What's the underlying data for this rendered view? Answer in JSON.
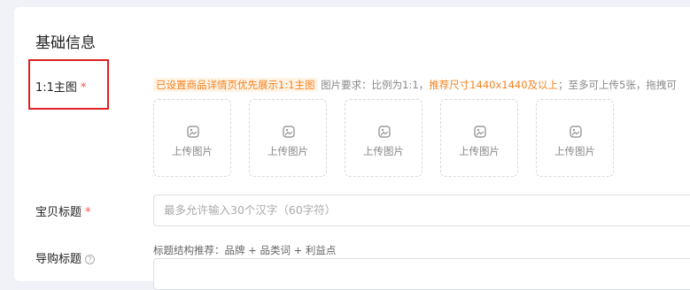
{
  "section": {
    "title": "基础信息"
  },
  "main_image": {
    "label": "1:1主图",
    "required_mark": "*",
    "tip_tag": "已设置商品详情页优先展示1:1主图",
    "tip_text_1": "图片要求：比例为1:1，",
    "tip_text_orange": "推荐尺寸1440x1440及以上",
    "tip_text_2": "；至多可上传5张，拖拽可",
    "upload_slots": [
      {
        "label": "上传图片"
      },
      {
        "label": "上传图片"
      },
      {
        "label": "上传图片"
      },
      {
        "label": "上传图片"
      },
      {
        "label": "上传图片"
      }
    ]
  },
  "title_field": {
    "label": "宝贝标题",
    "required_mark": "*",
    "placeholder": "最多允许输入30个汉字（60字符）"
  },
  "guide_title": {
    "label": "导购标题",
    "help_icon": "?",
    "hint": "标题结构推荐：品牌 + 品类词 + 利益点"
  },
  "colors": {
    "accent_orange": "#f5811f",
    "required_red": "#ff4d4f",
    "highlight_box": "#e02020"
  }
}
